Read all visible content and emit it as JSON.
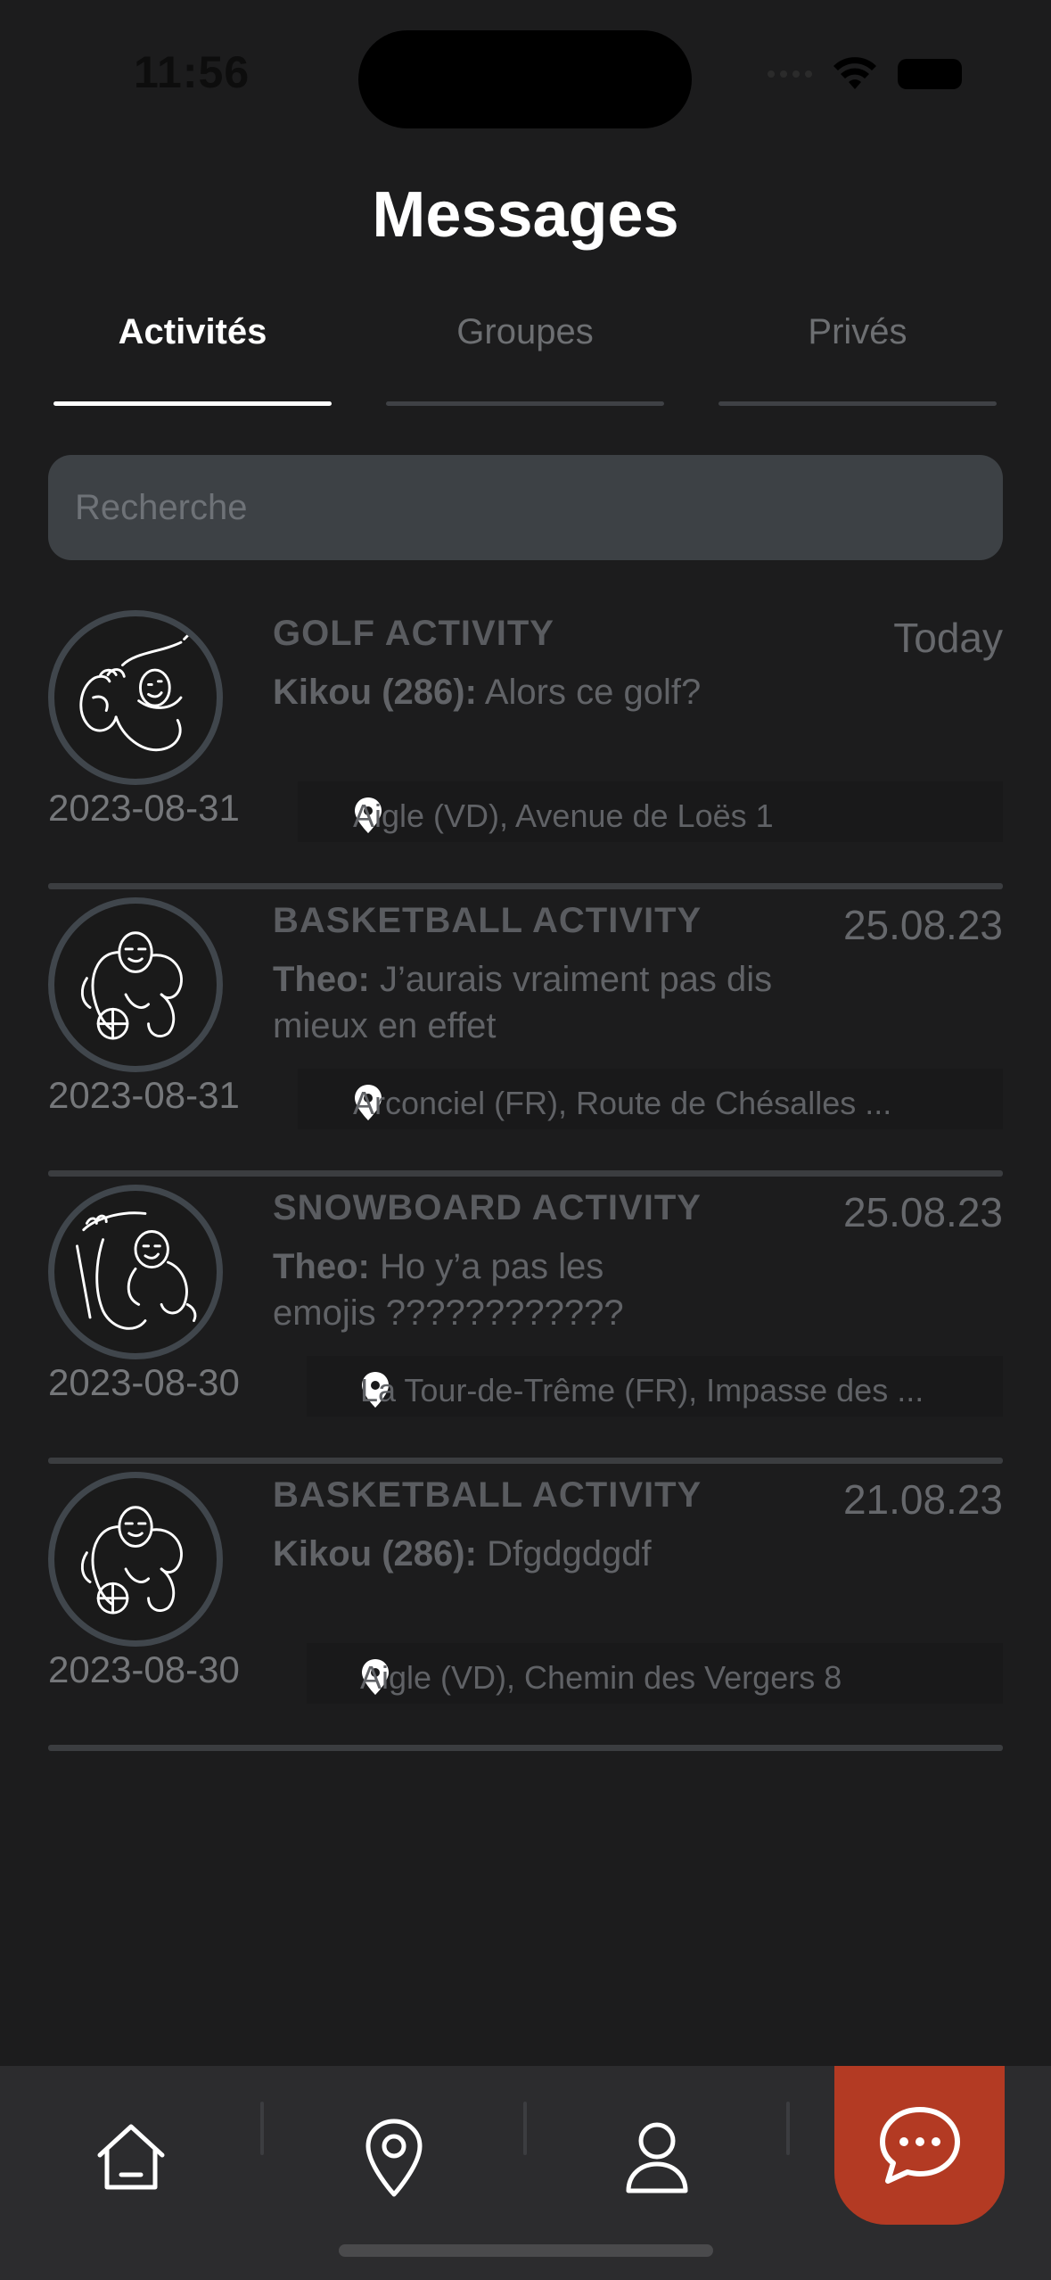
{
  "status_bar": {
    "time": "11:56"
  },
  "header": {
    "title": "Messages"
  },
  "tabs": [
    {
      "label": "Activités",
      "active": true
    },
    {
      "label": "Groupes",
      "active": false
    },
    {
      "label": "Privés",
      "active": false
    }
  ],
  "search": {
    "placeholder": "Recherche",
    "value": ""
  },
  "activities": [
    {
      "title": "GOLF ACTIVITY",
      "date_right": "Today",
      "sender": "Kikou (286):",
      "message": "Alors ce golf?",
      "date_left": "2023-08-31",
      "location": "Aigle (VD), Avenue de Loës 1",
      "avatar_icon": "golf-illustration-icon"
    },
    {
      "title": "BASKETBALL ACTIVITY",
      "date_right": "25.08.23",
      "sender": "Theo:",
      "message": "J’aurais vraiment pas dis mieux en effet",
      "date_left": "2023-08-31",
      "location": "Arconciel (FR), Route de Chésalles ...",
      "avatar_icon": "basketball-illustration-icon"
    },
    {
      "title": "SNOWBOARD ACTIVITY",
      "date_right": "25.08.23",
      "sender": "Theo:",
      "message": "Ho y’a pas les emojis ????????????",
      "date_left": "2023-08-30",
      "location": "La Tour-de-Trême (FR), Impasse des ...",
      "avatar_icon": "snowboard-illustration-icon"
    },
    {
      "title": "BASKETBALL ACTIVITY",
      "date_right": "21.08.23",
      "sender": "Kikou (286):",
      "message": "Dfgdgdgdf",
      "date_left": "2023-08-30",
      "location": "Aigle (VD), Chemin des Vergers 8",
      "avatar_icon": "basketball-illustration-icon"
    }
  ],
  "bottom_nav": [
    {
      "icon": "home-icon",
      "active": false
    },
    {
      "icon": "map-pin-icon",
      "active": false
    },
    {
      "icon": "profile-icon",
      "active": false
    },
    {
      "icon": "chat-icon",
      "active": true
    }
  ],
  "colors": {
    "accent": "#b33a23",
    "background": "#1c1c1d",
    "search_bg": "#3d4145"
  }
}
